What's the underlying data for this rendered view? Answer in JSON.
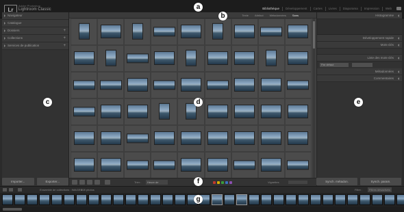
{
  "app": {
    "logo": "Lr",
    "subtitle_small": "Adobe Photoshop",
    "title": "Lightroom Classic"
  },
  "modules": [
    "Bibliothèque",
    "Développement",
    "Cartes",
    "Livres",
    "Diaporama",
    "Impression",
    "Web"
  ],
  "active_module": "Bibliothèque",
  "filter_bar": {
    "items": [
      "Texte",
      "Attribut",
      "Métadonnées",
      "Sans"
    ],
    "active": "Sans"
  },
  "left_panel": {
    "sections": [
      {
        "label": "Navigateur",
        "plus": ""
      },
      {
        "label": "Catalogue",
        "plus": ""
      },
      {
        "label": "Dossiers",
        "plus": "+"
      },
      {
        "label": "Collections",
        "plus": "+"
      },
      {
        "label": "Services de publication",
        "plus": "+"
      }
    ],
    "footer": {
      "import_label": "Importer...",
      "export_label": "Exporter..."
    }
  },
  "right_panel": {
    "sections": [
      {
        "label": "Histogramme"
      },
      {
        "label": "Développement rapide"
      },
      {
        "label": "Mots-clés"
      },
      {
        "label": "Liste des mots-clés"
      },
      {
        "label": "Métadonnées"
      },
      {
        "label": "Commentaires"
      }
    ],
    "preset_value": "Par défaut",
    "footer": {
      "sync_meta_label": "Synch. métadon.",
      "sync_settings_label": "Synch. param."
    }
  },
  "toolbar": {
    "sort_label": "Trier :",
    "sort_value": "Heure de capture",
    "thumbnails_label": "Vignettes",
    "color_labels": [
      "#c0392b",
      "#d4b000",
      "#3a9d3a",
      "#3a6fc0",
      "#8b4fb0"
    ]
  },
  "filmstrip": {
    "source_text": "Ensemble de collections : IMAGES",
    "count_text": "408 photos",
    "filter_label": "Filtre :",
    "filter_value": "Filtres désactivés"
  },
  "callouts": [
    "a",
    "b",
    "c",
    "d",
    "e",
    "f",
    "g"
  ],
  "grid": {
    "rows": 6,
    "cols": 9
  }
}
